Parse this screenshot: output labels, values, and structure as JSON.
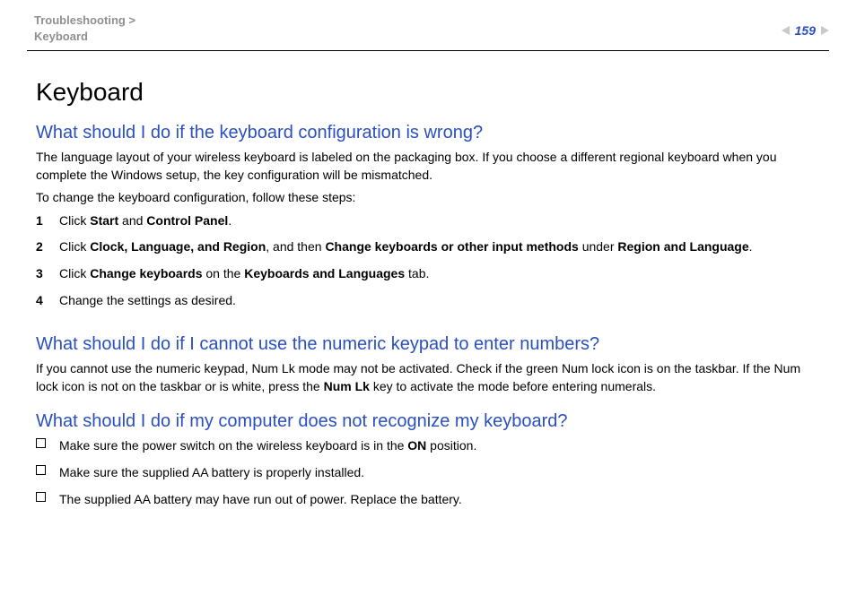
{
  "header": {
    "breadcrumb_line1": "Troubleshooting >",
    "breadcrumb_line2": "Keyboard",
    "page_number": "159"
  },
  "title": "Keyboard",
  "sections": [
    {
      "question": "What should I do if the keyboard configuration is wrong?",
      "paragraphs": [
        "The language layout of your wireless keyboard is labeled on the packaging box. If you choose a different regional keyboard when you complete the Windows setup, the key configuration will be mismatched.",
        "To change the keyboard configuration, follow these steps:"
      ],
      "steps": [
        {
          "pre": "Click ",
          "b1": "Start",
          "mid1": " and ",
          "b2": "Control Panel",
          "post": "."
        },
        {
          "pre": "Click ",
          "b1": "Clock, Language, and Region",
          "mid1": ", and then ",
          "b2": "Change keyboards or other input methods",
          "mid2": " under ",
          "b3": "Region and Language",
          "post": "."
        },
        {
          "pre": "Click ",
          "b1": "Change keyboards",
          "mid1": " on the ",
          "b2": "Keyboards and Languages",
          "post": " tab."
        },
        {
          "pre": "Change the settings as desired."
        }
      ]
    },
    {
      "question": "What should I do if I cannot use the numeric keypad to enter numbers?",
      "paragraphs": [
        {
          "pre": "If you cannot use the numeric keypad, Num Lk mode may not be activated. Check if the green Num lock icon is on the taskbar. If the Num lock icon is not on the taskbar or is white, press the ",
          "b1": "Num Lk",
          "post": " key to activate the mode before entering numerals."
        }
      ]
    },
    {
      "question": "What should I do if my computer does not recognize my keyboard?",
      "checks": [
        {
          "pre": "Make sure the power switch on the wireless keyboard is in the ",
          "b1": "ON",
          "post": " position."
        },
        {
          "pre": "Make sure the supplied AA battery is properly installed."
        },
        {
          "pre": "The supplied AA battery may have run out of power. Replace the battery."
        }
      ]
    }
  ]
}
